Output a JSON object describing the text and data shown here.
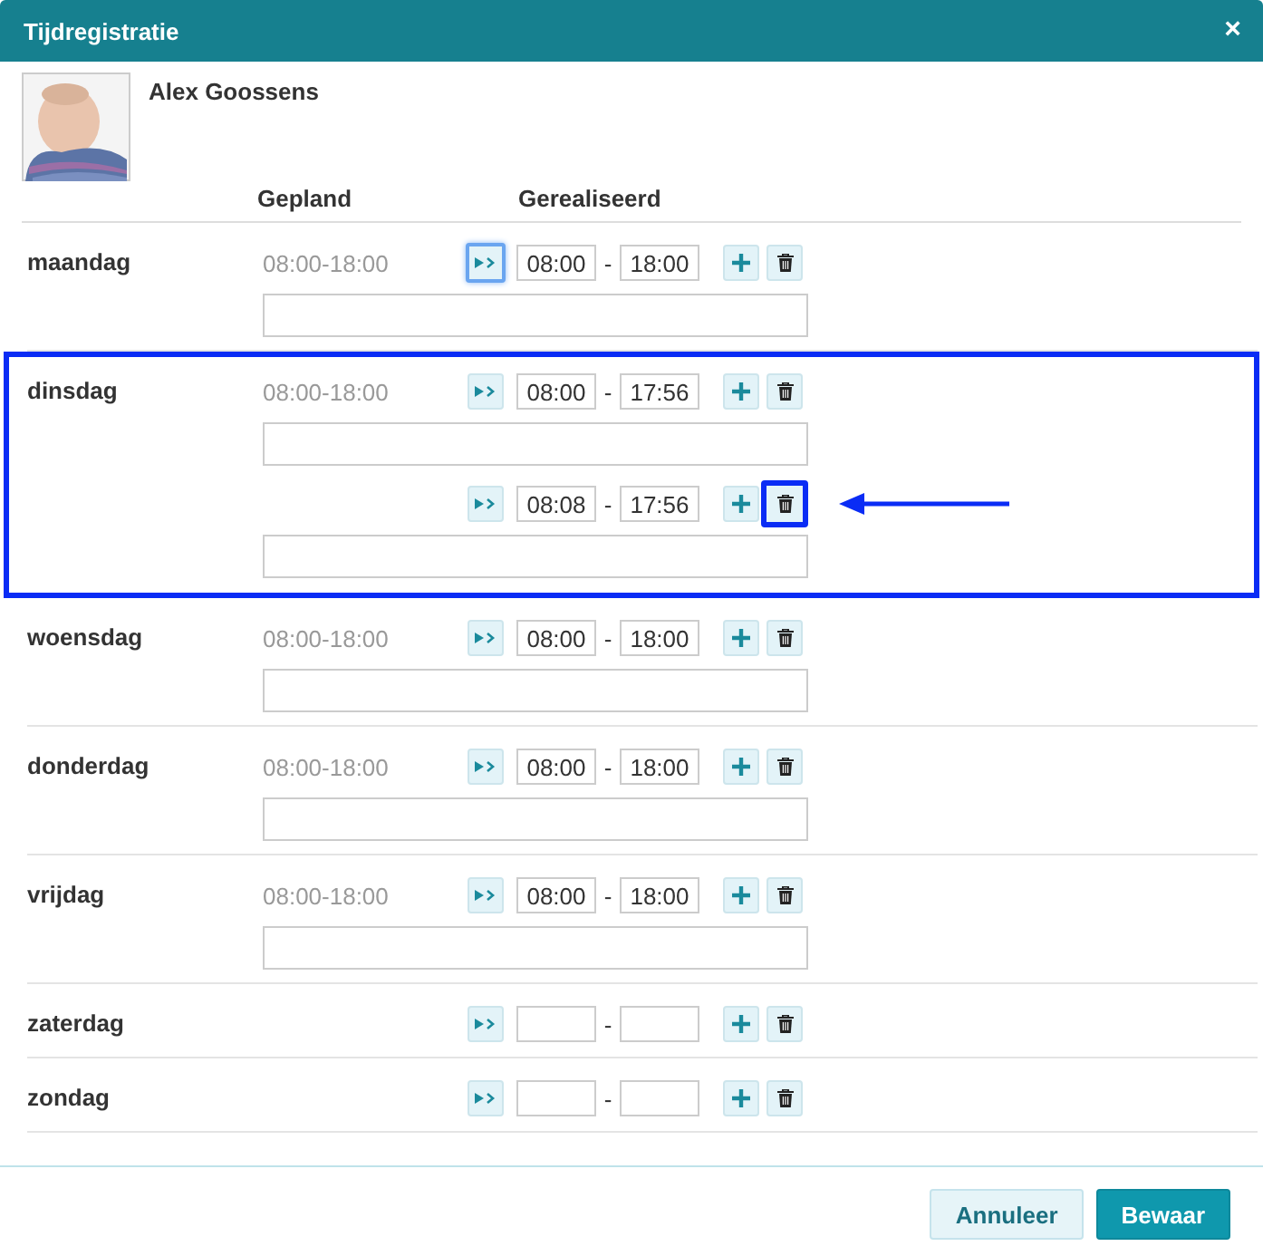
{
  "window": {
    "title": "Tijdregistratie",
    "close": "×"
  },
  "person": {
    "name": "Alex Goossens"
  },
  "columns": {
    "planned": "Gepland",
    "realised": "Gerealiseerd",
    "separator": "-"
  },
  "days": [
    {
      "name": "maandag",
      "planned": "08:00-18:00",
      "highlighted": false,
      "entries": [
        {
          "start": "08:00",
          "end": "18:00",
          "has_note": true,
          "copy_focused": true,
          "trash_highlighted": false
        }
      ]
    },
    {
      "name": "dinsdag",
      "planned": "08:00-18:00",
      "highlighted": true,
      "entries": [
        {
          "start": "08:00",
          "end": "17:56",
          "has_note": true,
          "copy_focused": false,
          "trash_highlighted": false
        },
        {
          "start": "08:08",
          "end": "17:56",
          "has_note": true,
          "copy_focused": false,
          "trash_highlighted": true
        }
      ]
    },
    {
      "name": "woensdag",
      "planned": "08:00-18:00",
      "highlighted": false,
      "entries": [
        {
          "start": "08:00",
          "end": "18:00",
          "has_note": true,
          "copy_focused": false,
          "trash_highlighted": false
        }
      ]
    },
    {
      "name": "donderdag",
      "planned": "08:00-18:00",
      "highlighted": false,
      "entries": [
        {
          "start": "08:00",
          "end": "18:00",
          "has_note": true,
          "copy_focused": false,
          "trash_highlighted": false
        }
      ]
    },
    {
      "name": "vrijdag",
      "planned": "08:00-18:00",
      "highlighted": false,
      "entries": [
        {
          "start": "08:00",
          "end": "18:00",
          "has_note": true,
          "copy_focused": false,
          "trash_highlighted": false
        }
      ]
    },
    {
      "name": "zaterdag",
      "highlighted": false,
      "entries": [
        {
          "has_note": false,
          "copy_focused": false,
          "trash_highlighted": false
        }
      ]
    },
    {
      "name": "zondag",
      "highlighted": false,
      "entries": [
        {
          "has_note": false,
          "copy_focused": false,
          "trash_highlighted": false
        }
      ]
    }
  ],
  "buttons": [
    {
      "label": "Annuleer",
      "kind": "secondary"
    },
    {
      "label": "Bewaar",
      "kind": "primary"
    }
  ]
}
